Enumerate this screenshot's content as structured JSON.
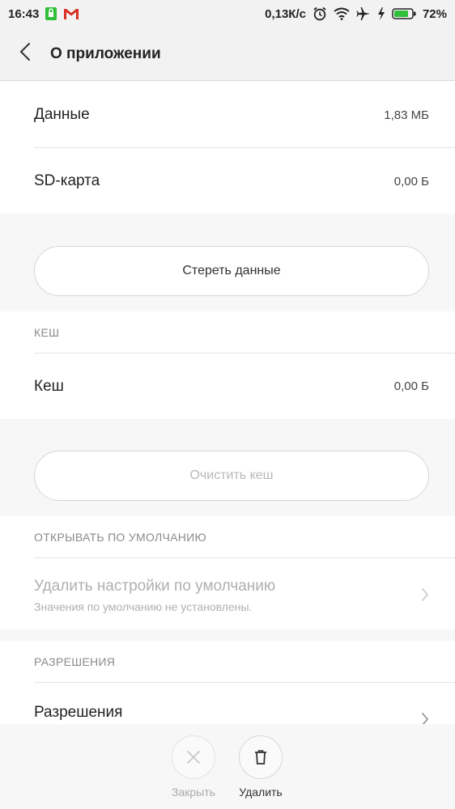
{
  "statusbar": {
    "time": "16:43",
    "speed": "0,13К/с",
    "battery": "72%",
    "icons": [
      "sim-lock-icon",
      "gmail-icon",
      "alarm-icon",
      "wifi-icon",
      "airplane-icon",
      "charging-icon",
      "battery-icon"
    ]
  },
  "header": {
    "title": "О приложении",
    "back_icon": "chevron-left-icon"
  },
  "storage": {
    "data_label": "Данные",
    "data_value": "1,83 МБ",
    "sd_label": "SD-карта",
    "sd_value": "0,00 Б",
    "clear_data_button": "Стереть данные"
  },
  "cache": {
    "section_title": "КЕШ",
    "cache_label": "Кеш",
    "cache_value": "0,00 Б",
    "clear_cache_button": "Очистить кеш"
  },
  "defaults": {
    "section_title": "ОТКРЫВАТЬ ПО УМОЛЧАНИЮ",
    "item_title": "Удалить настройки по умолчанию",
    "item_subtitle": "Значения по умолчанию не установлены."
  },
  "permissions": {
    "section_title": "РАЗРЕШЕНИЯ",
    "item_title": "Разрешения"
  },
  "bottom_actions": {
    "close_label": "Закрыть",
    "delete_label": "Удалить"
  },
  "colors": {
    "battery_green": "#2fbf3a",
    "gmail_red": "#d93025",
    "sim_green": "#2fbf3a"
  }
}
